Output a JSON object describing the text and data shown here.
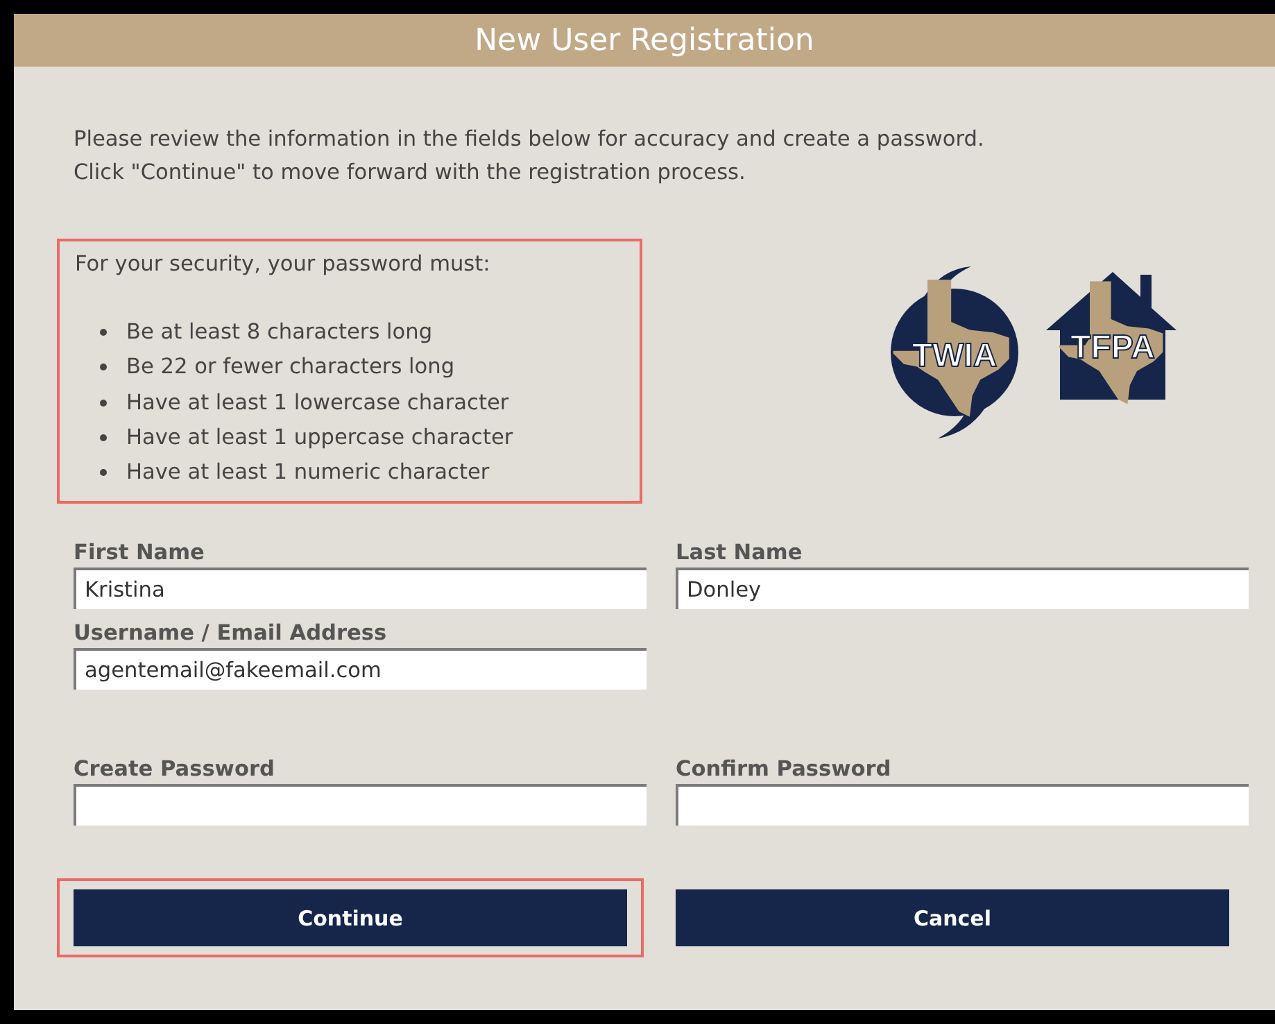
{
  "header": {
    "title": "New User Registration"
  },
  "instructions": [
    "Please review the information in the fields below for accuracy and create a password.",
    "Click \"Continue\" to move forward with the registration process."
  ],
  "requirements": {
    "highlighted": true,
    "heading": "For your security, your password must:",
    "items": [
      "Be at least 8 characters long",
      "Be 22 or fewer characters long",
      "Have at least 1 lowercase character",
      "Have at least 1 uppercase character",
      "Have at least 1 numeric character"
    ]
  },
  "logos": [
    {
      "kind": "storm",
      "text": "TWIA"
    },
    {
      "kind": "house",
      "text": "TFPA"
    }
  ],
  "field_rows": [
    [
      {
        "label": "First Name",
        "value": "Kristina"
      },
      {
        "label": "Last Name",
        "value": "Donley"
      }
    ],
    [
      {
        "label": "Username / Email Address",
        "value": "agentemail@fakeemail.com"
      }
    ],
    [
      {
        "label": "Create Password"
      },
      {
        "label": "Confirm Password"
      }
    ]
  ],
  "buttons": [
    {
      "label": "Continue",
      "highlighted": true
    },
    {
      "label": "Cancel",
      "highlighted": false
    }
  ]
}
